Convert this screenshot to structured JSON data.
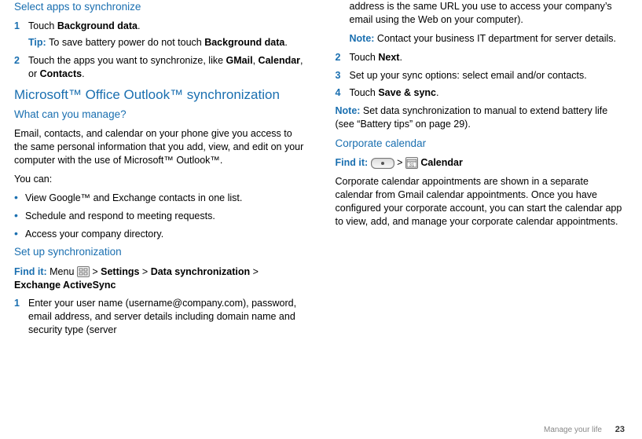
{
  "left": {
    "h_select_apps": "Select apps to synchronize",
    "step1_a": "Touch ",
    "step1_b": "Background data",
    "step1_c": ".",
    "tip_label": "Tip: ",
    "tip_a": "To save battery power do not touch ",
    "tip_b": "Background data",
    "tip_c": ".",
    "step2_a": "Touch the apps you want to synchronize, like ",
    "step2_b": "GMail",
    "step2_c": ", ",
    "step2_d": "Calendar",
    "step2_e": ", or ",
    "step2_f": "Contacts",
    "step2_g": ".",
    "h_outlook": "Microsoft™ Office Outlook™ synchronization",
    "h_whatmanage": "What can you manage?",
    "p_manage": "Email, contacts, and calendar on your phone give you access to the same personal information that you add, view, and edit on your computer with the use of Microsoft™  Outlook™.",
    "p_youcan": "You can:",
    "bul1": "View Google™ and Exchange contacts in one list.",
    "bul2": "Schedule and respond to meeting requests.",
    "bul3": "Access your company directory.",
    "h_setup": "Set up synchronization",
    "findit_label": "Find it: ",
    "findit_a": "Menu ",
    "findit_b": " > ",
    "findit_c": "Settings",
    "findit_d": " > ",
    "findit_e": "Data synchronization",
    "findit_f": " > ",
    "findit_g": "Exchange ActiveSync",
    "setup_step1": "Enter your user name (username@company.com), password, email address, and server details including domain name and security type (server "
  },
  "right": {
    "p_cont": "address is the same URL you use to access your company’s email using the Web on your computer).",
    "note1_label": "Note: ",
    "note1_text": "Contact your business IT department for server details.",
    "step2_a": "Touch ",
    "step2_b": "Next",
    "step2_c": ".",
    "step3": "Set up your sync options: select email and/or contacts.",
    "step4_a": "Touch ",
    "step4_b": "Save & sync",
    "step4_c": ".",
    "note2_label": "Note: ",
    "note2_text": "Set data synchronization to manual to extend battery life (see “Battery tips” on page 29).",
    "h_corpcal": "Corporate calendar",
    "findit2_label": "Find it:  ",
    "findit2_gt": "  >  ",
    "findit2_cal": "Calendar",
    "p_corpcal": "Corporate calendar appointments are shown in a separate calendar from Gmail calendar appointments. Once you have configured your corporate account, you can start the calendar app to view, add, and manage your corporate calendar appointments."
  },
  "footer": {
    "section": "Manage your life",
    "page": "23"
  }
}
